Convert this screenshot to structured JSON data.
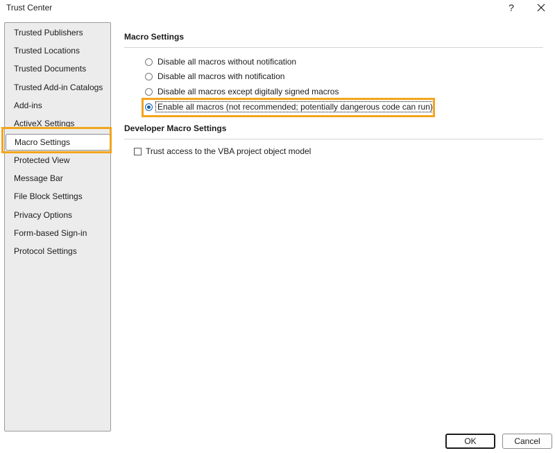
{
  "window": {
    "title": "Trust Center",
    "help_label": "?",
    "close_icon": "close-icon"
  },
  "sidebar": {
    "items": [
      {
        "label": "Trusted Publishers"
      },
      {
        "label": "Trusted Locations"
      },
      {
        "label": "Trusted Documents"
      },
      {
        "label": "Trusted Add-in Catalogs"
      },
      {
        "label": "Add-ins"
      },
      {
        "label": "ActiveX Settings"
      },
      {
        "label": "Macro Settings",
        "selected": true
      },
      {
        "label": "Protected View"
      },
      {
        "label": "Message Bar"
      },
      {
        "label": "File Block Settings"
      },
      {
        "label": "Privacy Options"
      },
      {
        "label": "Form-based Sign-in"
      },
      {
        "label": "Protocol Settings"
      }
    ]
  },
  "macro_settings": {
    "title": "Macro Settings",
    "options": [
      {
        "label": "Disable all macros without notification",
        "checked": false
      },
      {
        "label": "Disable all macros with notification",
        "checked": false
      },
      {
        "label": "Disable all macros except digitally signed macros",
        "checked": false
      },
      {
        "label": "Enable all macros (not recommended; potentially dangerous code can run)",
        "checked": true
      }
    ]
  },
  "developer_macro_settings": {
    "title": "Developer Macro Settings",
    "trust_vba_label": "Trust access to the VBA project object model",
    "trust_vba_checked": false
  },
  "footer": {
    "ok_label": "OK",
    "cancel_label": "Cancel"
  },
  "colors": {
    "highlight": "#f2a51c",
    "radio_accent": "#0f5fb8",
    "sidebar_bg": "#ececec"
  }
}
